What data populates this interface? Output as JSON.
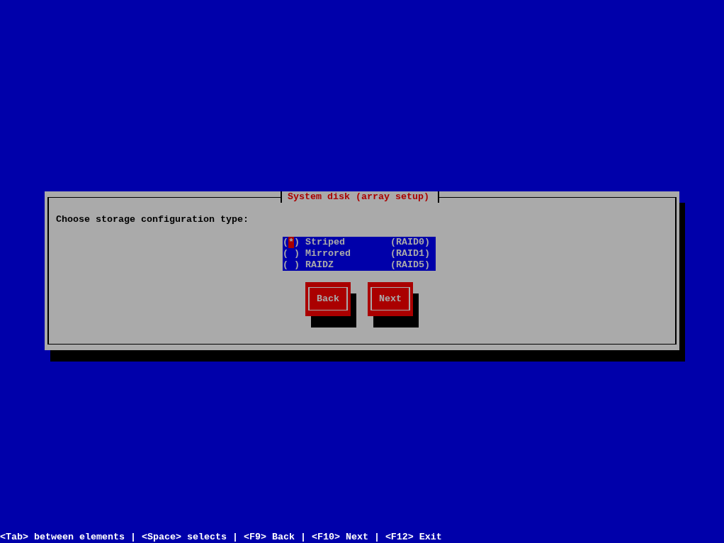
{
  "dialog": {
    "title": "System disk (array setup)",
    "prompt": "Choose storage configuration type:",
    "options": [
      {
        "radio": "(*)",
        "label": "Striped",
        "tag": "(RAID0)",
        "selected": true
      },
      {
        "radio": "( )",
        "label": "Mirrored",
        "tag": "(RAID1)",
        "selected": false
      },
      {
        "radio": "( )",
        "label": "RAIDZ",
        "tag": "(RAID5)",
        "selected": false
      }
    ],
    "buttons": [
      "Back",
      "Next"
    ]
  },
  "status_bar": "<Tab> between elements | <Space> selects | <F9> Back | <F10> Next | <F12> Exit"
}
